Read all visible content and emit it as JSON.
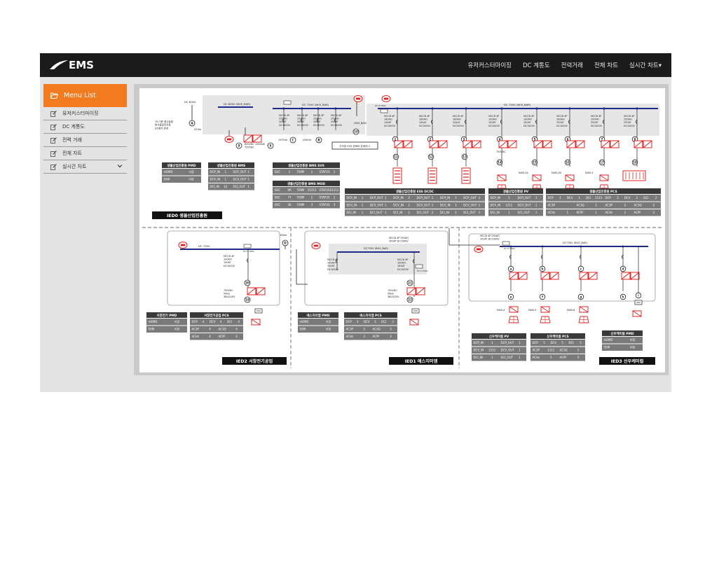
{
  "header": {
    "logo_text": "EMS",
    "nav": [
      "유저커스터마이징",
      "DC 계통도",
      "전력거래",
      "전체 차트",
      "실시간 차트▾"
    ]
  },
  "sidebar": {
    "title": "Menu List",
    "items": [
      "유저커스터마이징",
      "DC 계통도",
      "전력 거래",
      "전체 차트",
      "실시간 차트"
    ]
  },
  "diagram": {
    "top": {
      "dc800": "DC 800V",
      "dc800_bus": "DC 800V (BUS_BAR)",
      "dc750_bus1": "DC 750V (BUS_BAR)",
      "dc750_bus2": "DC 750V (BUS_BAR)",
      "bus_label": "(BUS_BAR)",
      "t0_note_1": "T0:기준 충수압량",
      "t0_note_2": "분사종압까지정",
      "t0_note_3": "DC회어 운영",
      "dist_520": "520m",
      "dist_1970": "1970m",
      "dist_1400": "1400m",
      "conv_note_1": "800VDC 1000kW",
      "conv_note_2": "750VDC",
      "ess_note": "주차장 ESS 컨버터 콘테이너",
      "mccb_left": [
        [
          "MCCB 4P",
          "250AF/",
          "200AT",
          "DC1000V"
        ],
        [
          "MCCB 4P",
          "250AF/",
          "200AT",
          "DC1000V"
        ],
        [
          "MCCB 4P",
          "250AF/",
          "200AT",
          "DC1000V"
        ],
        [
          "MCCB 4P",
          "250AF/",
          "200AT",
          "DC1000V"
        ]
      ],
      "mccb_right": [
        [
          "MCCB 4P",
          "160AF/",
          "144AT",
          "DC1000V"
        ],
        [
          "MCCB 4P",
          "160AF/",
          "144AT",
          "DC1000V"
        ],
        [
          "MCCB 4P",
          "160AF/",
          "144AT",
          "DC1000V"
        ],
        [
          "MCCB 4P",
          "100AF/",
          "100AT",
          "DC1000V"
        ],
        [
          "MCCB 4P",
          "100AF/",
          "100AT",
          "DC1000V"
        ],
        [
          "MCCB 4P",
          "100AF/",
          "100AT",
          "DC1000V"
        ],
        [
          "MCCB 4P",
          "250AF/",
          "250AT",
          "DC1000V"
        ],
        [
          "MCCB 4P",
          "250AF/",
          "250AT",
          "DC1000V"
        ]
      ],
      "dcct": "DC CT 200A",
      "nums_left": [
        "A",
        "B",
        "C",
        "9",
        "10"
      ],
      "nums_right": [
        "1",
        "2",
        "3",
        "4",
        "5",
        "6",
        "7",
        "8",
        "11",
        "12",
        "13",
        "14",
        "15",
        "16",
        "17",
        "18"
      ],
      "load_labels": [
        "NUB-2A",
        "NUB-2B",
        "NUB-3"
      ],
      "rating_750": "750VDC"
    },
    "ied0_label": "IED0 생물산업진흥원",
    "ied1_label": "IED1 에스지이엠",
    "ied2_label": "IED2 서창전기공업",
    "ied3_label": "IED3 신우케미컬",
    "tables": {
      "pmd0": {
        "title": "생물산업진흥원 PMD",
        "rows": [
          [
            "mEMD",
            "미정"
          ],
          [
            "SSM",
            "미정"
          ]
        ]
      },
      "bmsi": {
        "title": "생물산업진흥원 BMS",
        "rows": [
          [
            "DCP_IN",
            "1",
            "DCP_OUT",
            "1"
          ],
          [
            "DCV_IN",
            "1",
            "DCV_OUT",
            "1"
          ],
          [
            "DCI_IN",
            "12",
            "DCI_OUT",
            "1"
          ]
        ]
      },
      "svs": {
        "title": "생물산업진흥원 BMS SVS",
        "rows": [
          [
            "SOC",
            "1",
            "TEMP",
            "1",
            "STATUS",
            "1"
          ]
        ]
      },
      "mod": {
        "title": "생물산업진흥원 BMS MOD",
        "rows": [
          [
            "SOC",
            "99",
            "TEMP",
            "11111",
            "STATUS",
            "11111"
          ],
          [
            "SOC",
            "77",
            "TEMP",
            "2",
            "STATUS",
            "2"
          ],
          [
            "SOC",
            "36",
            "TEMP",
            "3",
            "STATUS",
            "3"
          ]
        ]
      },
      "dcdc": {
        "title": "생물산업진흥원 ESS DCDC",
        "rows": [
          [
            "DCP_IN",
            "1",
            "DCP_OUT",
            "1",
            "DCP_IN",
            "2",
            "DCP_OUT",
            "2",
            "DCP_IN",
            "3",
            "DCP_OUT",
            "3"
          ],
          [
            "DCV_IN",
            "1",
            "DCV_OUT",
            "1",
            "DCV_IN",
            "2",
            "DCV_OUT",
            "2",
            "DCV_IN",
            "3",
            "DCV_OUT",
            "3"
          ],
          [
            "DCI_IN",
            "1",
            "DCI_OUT",
            "1",
            "DCI_IN",
            "2",
            "DCI_OUT",
            "2",
            "DCI_IN",
            "3",
            "DCI_OUT",
            "3"
          ]
        ]
      },
      "pv0": {
        "title": "생물산업진흥원 PV",
        "rows": [
          [
            "DCP_IN",
            "1",
            "DCP_OUT",
            "1"
          ],
          [
            "DCV_IN",
            "1212",
            "DCV_OUT",
            "1"
          ],
          [
            "DCI_IN",
            "1",
            "DCI_OUT",
            "1"
          ]
        ]
      },
      "pcs0": {
        "title": "생물산업진흥원 PCS",
        "rows": [
          [
            "DCP",
            "1",
            "DCV",
            "1",
            "DCI",
            "1111",
            "DCP",
            "2",
            "DCV",
            "2",
            "DCI",
            "2"
          ],
          [
            "AC3P",
            "",
            "AC3Q",
            "1",
            "AC3P",
            "2",
            "AC3Q",
            "2"
          ],
          [
            "ACHz",
            "1",
            "ACPF",
            "1",
            "ACHz",
            "2",
            "ACPF",
            "2"
          ]
        ]
      },
      "pmd2": {
        "title": "서창전기 PMD",
        "rows": [
          [
            "mEMD",
            "미정"
          ],
          [
            "SSM",
            "미정"
          ]
        ]
      },
      "pcs2": {
        "title": "서창전기공업 PCS",
        "rows": [
          [
            "DCP",
            "4",
            "DCV",
            "4",
            "DCI",
            "4"
          ],
          [
            "AC3P",
            "4",
            "AC3Q",
            "4"
          ],
          [
            "ACHz",
            "4",
            "ACPF",
            "4"
          ]
        ]
      },
      "pmd1": {
        "title": "에스지이엠 PMD",
        "rows": [
          [
            "mEMD",
            "미정"
          ],
          [
            "SSM",
            "미정"
          ]
        ]
      },
      "pcs1": {
        "title": "에스지이엠 PCS",
        "rows": [
          [
            "DCP",
            "3",
            "DCV",
            "3",
            "DCI",
            "3"
          ],
          [
            "AC3P",
            "3",
            "AC3Q",
            "3"
          ],
          [
            "ACHz",
            "3",
            "ACPF",
            "3"
          ]
        ]
      },
      "pv3": {
        "title": "신우케미컬 PV",
        "rows": [
          [
            "DCP_IN",
            "1",
            "DCP_OUT",
            "1"
          ],
          [
            "DCV_IN",
            "1212",
            "DCV_OUT",
            "1"
          ],
          [
            "DCI_IN",
            "1",
            "DCI_OUT",
            "1"
          ]
        ]
      },
      "pcs3": {
        "title": "신우케미컬 PCS",
        "rows": [
          [
            "DCP",
            "5",
            "DCV",
            "5",
            "DCI",
            "5"
          ],
          [
            "AC3P",
            "1111",
            "AC3Q",
            "5"
          ],
          [
            "ACHz",
            "5",
            "ACPF",
            "5"
          ]
        ]
      },
      "pmd3": {
        "title": "신우케미컬 PMD",
        "rows": [
          [
            "mEMD",
            "미정"
          ],
          [
            "SSM",
            "미정"
          ]
        ]
      }
    },
    "ied2": {
      "dc750": "DC 750V",
      "dist": "180m",
      "mccb": [
        "MCCB 4P",
        "100AF/",
        "100AT",
        "DC1000V"
      ],
      "dcct": "DC CT 200A",
      "conv": [
        "750VDC",
        "50kw",
        "380/220V"
      ],
      "nums": [
        "D",
        "20",
        "19"
      ]
    },
    "ied1": {
      "bus": "DC750V (BUS_BAR)",
      "mccb_l": [
        "MCCB 4P",
        "100AF/",
        "100AT",
        "DC1000V"
      ],
      "mccb_r": [
        "MCCB 4P",
        "100AF/",
        "100AT",
        "DC1000V"
      ],
      "mccb_top": [
        "MCCB 4P 250AF/",
        "200AT DC1000V"
      ],
      "dcct": "DC CT 200A",
      "conv": [
        "750VDC",
        "50kw",
        "380/220V"
      ],
      "nums": [
        "21",
        "22"
      ]
    },
    "ied3": {
      "bus": "DC750V (BUS_BAR)",
      "mccb_top": [
        "MCCB 4P 250AF/",
        "200AT DC1000V"
      ],
      "dcct": "DC CT 200A",
      "nums": [
        "a",
        "b",
        "c",
        "d",
        "e",
        "f",
        "g",
        "h",
        "i"
      ],
      "loads": [
        "NUB-4",
        "NUB-5",
        "NUB-6"
      ]
    }
  },
  "colors": {
    "accent": "#f27a1f",
    "topbar": "#1b1b1b",
    "bus": "#1f2a8c",
    "red": "#e02020",
    "table_head": "#3a3a3a",
    "table_cell": "#7a7a7a"
  }
}
